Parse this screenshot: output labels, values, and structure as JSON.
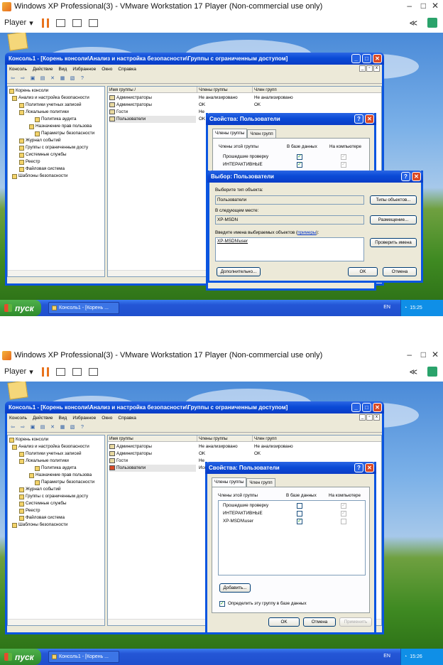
{
  "vmware": {
    "title": "Windows XP Professional(3) - VMware Workstation 17 Player (Non-commercial use only)",
    "player_label": "Player",
    "minimize": "–",
    "maximize": "□",
    "close": "✕",
    "back": "≪"
  },
  "mmc": {
    "title": "Консоль1 - [Корень консоли\\Анализ и настройка безопасности\\Группы с ограниченным доступом]",
    "menu": [
      "Консоль",
      "Действие",
      "Вид",
      "Избранное",
      "Окно",
      "Справка"
    ],
    "tree": [
      {
        "label": "Корень консоли",
        "level": 0
      },
      {
        "label": "Анализ и настройка безопасности",
        "level": 1
      },
      {
        "label": "Политики учетных записей",
        "level": 2
      },
      {
        "label": "Локальные политики",
        "level": 2
      },
      {
        "label": "Политика аудита",
        "level": 3
      },
      {
        "label": "Назначение прав пользова",
        "level": 3
      },
      {
        "label": "Параметры безопасности",
        "level": 3
      },
      {
        "label": "Журнал событий",
        "level": 2
      },
      {
        "label": "Группы с ограниченным досту",
        "level": 2
      },
      {
        "label": "Системные службы",
        "level": 2
      },
      {
        "label": "Реестр",
        "level": 2
      },
      {
        "label": "Файловая система",
        "level": 2
      },
      {
        "label": "Шаблоны безопасности",
        "level": 1
      }
    ],
    "columns": [
      "Имя группы",
      "Члены группы",
      "Член групп"
    ],
    "sort_indicator": "/",
    "rows_top": [
      [
        "Администраторы",
        "Не анализировано",
        "Не анализировано"
      ],
      [
        "Администраторы",
        "OK",
        "OK"
      ],
      [
        "Гости",
        "Не",
        ""
      ],
      [
        "Пользователи",
        "OK",
        ""
      ]
    ],
    "rows_bottom": [
      [
        "Администраторы",
        "Не анализировано",
        "Не анализировано"
      ],
      [
        "Администраторы",
        "OK",
        "OK"
      ],
      [
        "Гости",
        "Не",
        ""
      ],
      [
        "Пользователи",
        "Исс",
        ""
      ]
    ]
  },
  "props": {
    "title": "Свойства: Пользователи",
    "tabs": [
      "Члены группы",
      "Член групп"
    ],
    "col_members": "Члены этой группы",
    "col_db": "В базе данных",
    "col_pc": "На компьютере",
    "members_top": [
      "Прошедшие проверку",
      "ИНТЕРАКТИВНЫЕ"
    ],
    "members_bottom": [
      "Прошедшие проверку",
      "ИНТЕРАКТИВНЫЕ",
      "XP-MSDN\\user"
    ],
    "add_btn": "Добавить...",
    "define_label": "Определить эту группу в базе данных",
    "ok": "OK",
    "cancel": "Отмена",
    "apply": "Применить"
  },
  "select": {
    "title": "Выбор: Пользователи",
    "type_label": "Выберите тип объекта:",
    "type_value": "Пользователи",
    "type_btn": "Типы объектов...",
    "loc_label": "В следующем месте:",
    "loc_value": "XP-MSDN",
    "loc_btn": "Размещение...",
    "names_label": "Введите имена выбираемых объектов (",
    "names_link": "примеры",
    "names_label_end": "):",
    "names_value": "XP-MSDN\\user",
    "check_btn": "Проверить имена",
    "advanced_btn": "Дополнительно...",
    "ok": "OK",
    "cancel": "Отмена"
  },
  "taskbar": {
    "start": "пуск",
    "task": "Консоль1 - [Корень ...",
    "lang": "EN",
    "time_top": "15:25",
    "time_bottom": "15:26"
  }
}
